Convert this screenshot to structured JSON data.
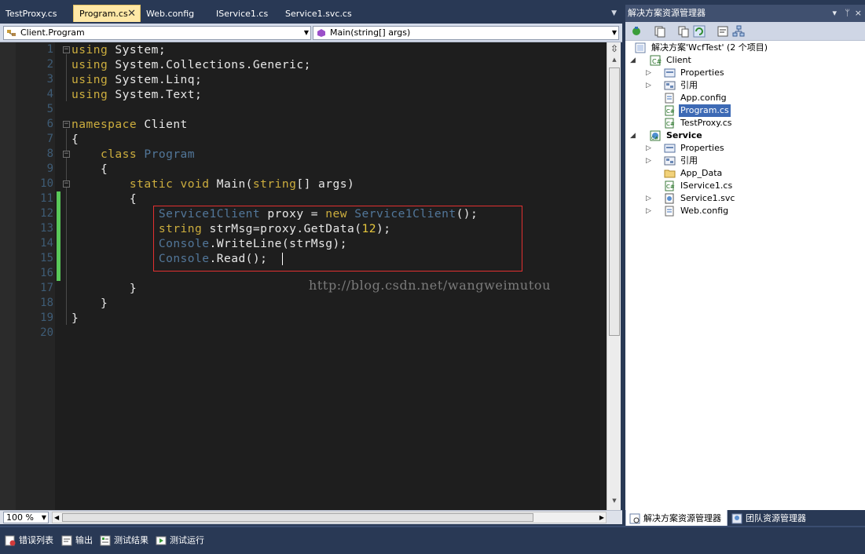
{
  "tabs": [
    {
      "label": "TestProxy.cs",
      "active": false
    },
    {
      "label": "Program.cs",
      "active": true
    },
    {
      "label": "Web.config",
      "active": false
    },
    {
      "label": "IService1.cs",
      "active": false
    },
    {
      "label": "Service1.svc.cs",
      "active": false
    }
  ],
  "nav": {
    "class_combo": "Client.Program",
    "member_combo": "Main(string[] args)"
  },
  "code": {
    "line_numbers": [
      "1",
      "2",
      "3",
      "4",
      "5",
      "6",
      "7",
      "8",
      "9",
      "10",
      "11",
      "12",
      "13",
      "14",
      "15",
      "16",
      "17",
      "18",
      "19",
      "20"
    ],
    "l1": {
      "kw": "using",
      "rest": " System;"
    },
    "l2": {
      "kw": "using",
      "rest": " System.Collections.Generic;"
    },
    "l3": {
      "kw": "using",
      "rest": " System.Linq;"
    },
    "l4": {
      "kw": "using",
      "rest": " System.Text;"
    },
    "l6": {
      "kw": "namespace",
      "rest": " Client"
    },
    "l7": "{",
    "l8": {
      "indent": "    ",
      "kw": "class",
      "type": " Program"
    },
    "l9": "    {",
    "l10": {
      "indent": "        ",
      "kw1": "static",
      "kw2": " void",
      "mid": " Main(",
      "kw3": "string",
      "rest": "[] args)"
    },
    "l11": "        {",
    "l12": {
      "indent": "            ",
      "t1": "Service1Client",
      "p1": " proxy = ",
      "kw": "new",
      "t2": " Service1Client",
      "p2": "();"
    },
    "l13": {
      "indent": "            ",
      "kw": "string",
      "p1": " strMsg=proxy.GetData(",
      "num": "12",
      "p2": ");"
    },
    "l14": {
      "indent": "            ",
      "t": "Console",
      "p": ".WriteLine(strMsg);"
    },
    "l15": {
      "indent": "            ",
      "t": "Console",
      "p": ".Read();"
    },
    "l17": "        }",
    "l18": "    }",
    "l19": "}"
  },
  "watermark": "http://blog.csdn.net/wangweimutou",
  "zoom": "100 %",
  "solution_explorer": {
    "title": "解决方案资源管理器",
    "pin_label": "ᛘ",
    "close_label": "×",
    "dropdown_label": "▾",
    "solution": "解决方案'WcfTest' (2 个项目)",
    "client": "Client",
    "client_items": [
      "Properties",
      "引用",
      "App.config",
      "Program.cs",
      "TestProxy.cs"
    ],
    "service": "Service",
    "service_items": [
      "Properties",
      "引用",
      "App_Data",
      "IService1.cs",
      "Service1.svc",
      "Web.config"
    ],
    "selected": "Program.cs"
  },
  "se_tabs": {
    "solution": "解决方案资源管理器",
    "team": "团队资源管理器"
  },
  "bottom_tabs": [
    "错误列表",
    "输出",
    "测试结果",
    "测试运行"
  ],
  "colors": {
    "keyword": "#cdae3e",
    "type": "#52779a",
    "number": "#e6c73d",
    "active_tab": "#ffe8a6",
    "chrome": "#293955"
  }
}
